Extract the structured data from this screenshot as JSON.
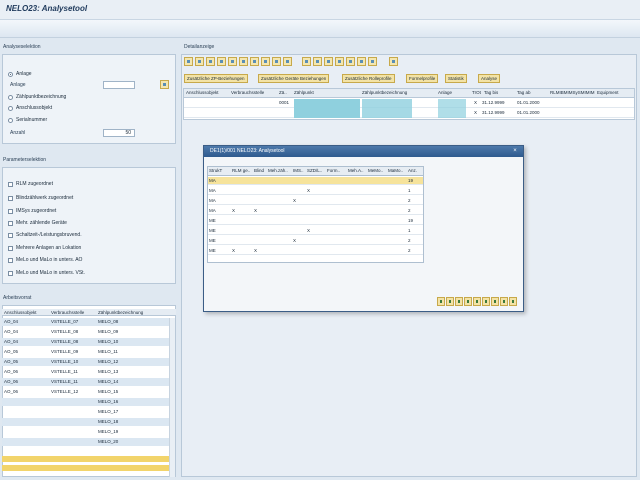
{
  "title": "NELO23: Analysetool",
  "left": {
    "analyse_label": "Analyseselektion",
    "radios": [
      {
        "label": "Anlage",
        "selected": true
      },
      {
        "label": "Anlage"
      },
      {
        "label": "Zählpunktbezeichnung"
      },
      {
        "label": "Anschlussobjekt"
      },
      {
        "label": "Serialnummer"
      }
    ],
    "anzahl_label": "Anzahl",
    "anzahl_value": "50",
    "param_label": "Parameterselektion",
    "checks": [
      "RLM zugeordnet",
      "Blindzählwerk zugeordnet",
      "IMSys zugeordnet",
      "Mehr. zählende Geräte",
      "Schaltzeit-/Leistungsbruvend.",
      "Mehrere Anlagen an Lokation",
      "MeLo und MaLo in unters. AO",
      "MeLo und MaLo in unters. VSt."
    ],
    "arbeitsvorrat_label": "Arbeitsvorrat",
    "av_headers": [
      "Anschlussobjekt",
      "Verbrauchsstelle",
      "Zählpunktbezeichnung"
    ],
    "av_rows": [
      [
        "AO_04",
        "VSTELLE_07",
        "MELO_08"
      ],
      [
        "AO_04",
        "VSTELLE_08",
        "MELO_09"
      ],
      [
        "AO_04",
        "VSTELLE_08",
        "MELO_10"
      ],
      [
        "AO_05",
        "VSTELLE_09",
        "MELO_11"
      ],
      [
        "AO_05",
        "VSTELLE_10",
        "MELO_12"
      ],
      [
        "AO_06",
        "VSTELLE_11",
        "MELO_13"
      ],
      [
        "AO_06",
        "VSTELLE_11",
        "MELO_14"
      ],
      [
        "AO_06",
        "VSTELLE_12",
        "MELO_15"
      ],
      [
        "",
        "",
        "MELO_16"
      ],
      [
        "",
        "",
        "MELO_17"
      ],
      [
        "",
        "",
        "MELO_18"
      ],
      [
        "",
        "",
        "MELO_19"
      ],
      [
        "",
        "",
        "MELO_20"
      ]
    ]
  },
  "right": {
    "detail_label": "Detailanzeige",
    "buttons": [
      "Zusätzliche ZP-Beziehungen",
      "Zusätzliche Geräte Beziehungen",
      "Zusätzliche Rolleprofile",
      "Formelprofile",
      "Statistik",
      "Analyse"
    ],
    "grid_headers": [
      "Anschlussobjekt",
      "Verbrauchsstelle",
      "Zä..",
      "Zählpunkt",
      "Zählpunktbezeichnung",
      "Anlage",
      "TrOt",
      "Tag bis",
      "Tag ab",
      "RLMIBMIMSySMIMIM",
      "Equipment"
    ],
    "grid_rows": [
      [
        "",
        "",
        "0001",
        "",
        "",
        "",
        "X",
        "31.12.9999",
        "01.01.2000",
        "",
        ""
      ],
      [
        "",
        "",
        "",
        "",
        "",
        "",
        "X",
        "31.12.9999",
        "01.01.2000",
        "",
        ""
      ]
    ]
  },
  "dialog": {
    "title": "DE1(1)/001 NELO23: Analysetool",
    "close": "×",
    "headers": [
      "StrukT",
      "RLM ge..",
      "Blind",
      "Meh.zäh..",
      "IMS..",
      "SZD/L..",
      "Form..",
      "Meh.A..",
      "MeMo..",
      "MaMo..",
      "Anz."
    ],
    "rows": [
      [
        "MA",
        "",
        "",
        "",
        "",
        "",
        "",
        "",
        "",
        "",
        "19"
      ],
      [
        "MA",
        "",
        "",
        "",
        "",
        "X",
        "",
        "",
        "",
        "",
        "1"
      ],
      [
        "MA",
        "",
        "",
        "",
        "X",
        "",
        "",
        "",
        "",
        "",
        "2"
      ],
      [
        "MA",
        "X",
        "X",
        "",
        "",
        "",
        "",
        "",
        "",
        "",
        "2"
      ],
      [
        "ME",
        "",
        "",
        "",
        "",
        "",
        "",
        "",
        "",
        "",
        "19"
      ],
      [
        "ME",
        "",
        "",
        "",
        "",
        "X",
        "",
        "",
        "",
        "",
        "1"
      ],
      [
        "ME",
        "",
        "",
        "",
        "X",
        "",
        "",
        "",
        "",
        "",
        "2"
      ],
      [
        "ME",
        "X",
        "X",
        "",
        "",
        "",
        "",
        "",
        "",
        "",
        "2"
      ]
    ]
  }
}
